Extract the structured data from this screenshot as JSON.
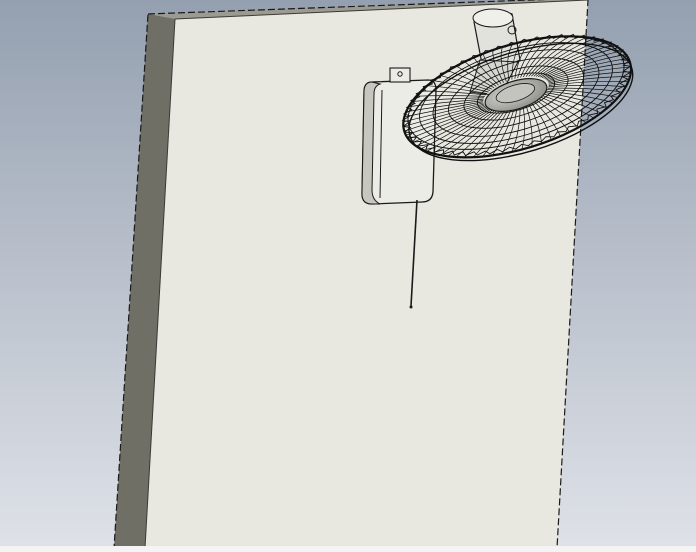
{
  "viewport": {
    "background_gradient": [
      "#94a0b0",
      "#c2c8d2",
      "#dfe2e8"
    ]
  },
  "model": {
    "panel": {
      "front_color": "#e8e8e0",
      "side_color": "#6f6f66",
      "top_color": "#9b9b92",
      "edge_color": "#1a1a1a"
    },
    "fan": {
      "bracket_color": "#ecece6",
      "guard_color": "#111111",
      "hub_color": "#a9a9a4",
      "motor_color": "#e2e2dc",
      "pull_cord_color": "#1a1a1a"
    }
  },
  "icons": {
    "panel": "wall-panel-icon",
    "fan": "wall-fan-icon"
  }
}
